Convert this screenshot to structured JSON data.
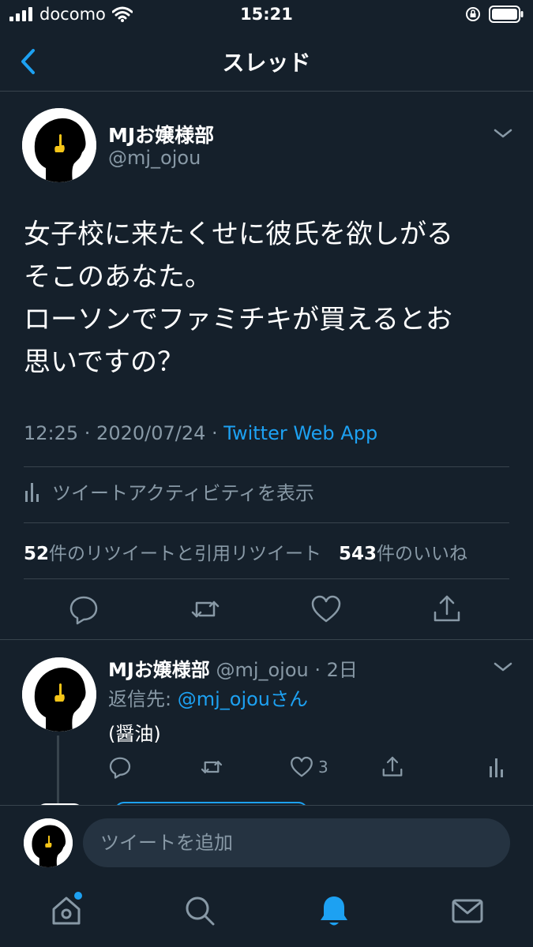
{
  "status_bar": {
    "carrier": "docomo",
    "time": "15:21"
  },
  "navbar": {
    "title": "スレッド"
  },
  "tweet": {
    "display_name": "MJお嬢様部",
    "handle": "@mj_ojou",
    "text_lines": [
      "女子校に来たくせに彼氏を欲しがる",
      "そこのあなた。",
      "ローソンでファミチキが買えるとお",
      "思いですの？"
    ],
    "timestamp": "12:25 · 2020/07/24 · ",
    "source_app": "Twitter Web App",
    "activity_label": "ツイートアクティビティを表示",
    "retweet_count": "52",
    "retweet_label": "件のリツイートと引用リツイート",
    "like_count": "543",
    "like_label": "件のいいね"
  },
  "reply": {
    "display_name": "MJお嬢様部",
    "handle_age": " @mj_ojou · 2日",
    "reply_to_prefix": "返信先: ",
    "reply_to_handle": "@mj_ojou",
    "reply_to_suffix": "さん",
    "text": "(醤油)",
    "like_count": "3"
  },
  "composer": {
    "placeholder": "ツイートを追加"
  },
  "colors": {
    "background": "#15202b",
    "accent": "#1da1f2",
    "muted": "#8899a6",
    "divider": "#38444d",
    "input_bg": "#253341"
  },
  "icons": [
    "signal-icon",
    "wifi-icon",
    "rotation-lock-icon",
    "battery-icon",
    "back-chevron-icon",
    "chevron-down-icon",
    "stats-icon",
    "reply-icon",
    "retweet-icon",
    "like-icon",
    "share-icon",
    "home-icon",
    "search-icon",
    "notifications-icon",
    "messages-icon"
  ]
}
